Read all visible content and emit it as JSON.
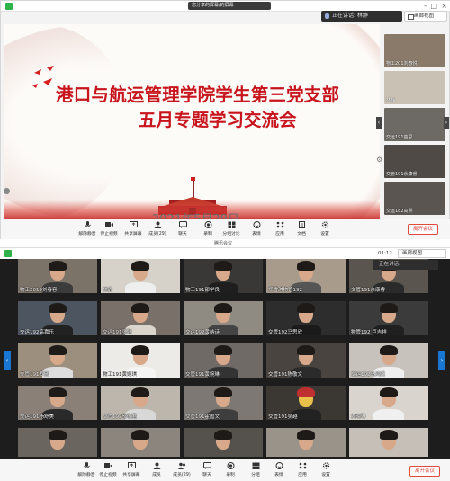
{
  "top_window": {
    "title": "您分享的屏幕/的屏幕",
    "speaking_label": "正在讲话: 林静",
    "gallery_view_label": "画廊视图",
    "slide": {
      "line1": "港口与航运管理学院学生第三党支部",
      "line2": "五月专题学习交流会",
      "date": "2021年5月28日"
    },
    "strip_tiles": [
      {
        "label": "物工201刘春悦"
      },
      {
        "label": "林静"
      },
      {
        "label": "交运191苗思"
      },
      {
        "label": "交管191余康睿"
      },
      {
        "label": "交运182高熙"
      }
    ],
    "toolbar": [
      {
        "label": "解除静音",
        "icon": "mic-icon"
      },
      {
        "label": "停止视频",
        "icon": "video-icon"
      },
      {
        "label": "共享屏幕",
        "icon": "share-screen-icon"
      },
      {
        "label": "成员(29)",
        "icon": "participants-icon"
      },
      {
        "label": "聊天",
        "icon": "chat-icon"
      },
      {
        "label": "录制",
        "icon": "record-icon"
      },
      {
        "label": "分组讨论",
        "icon": "breakout-icon"
      },
      {
        "label": "表情",
        "icon": "reaction-icon"
      },
      {
        "label": "应用",
        "icon": "apps-icon"
      },
      {
        "label": "文档",
        "icon": "docs-icon"
      },
      {
        "label": "设置",
        "icon": "settings-icon"
      }
    ],
    "leave_label": "离开会议"
  },
  "bottom_window": {
    "title": "腾讯会议",
    "time": "01:12",
    "gallery_view_label": "画廊视图",
    "speaking_label": "正在讲话:",
    "tiles": [
      {
        "name": "物工2019刘春容"
      },
      {
        "name": "林静"
      },
      {
        "name": "物工191邵学良"
      },
      {
        "name": "郑雪琪物管192"
      },
      {
        "name": "交管191余康睿"
      },
      {
        "name": "交运192高嘉乐"
      },
      {
        "name": "交运191张骁"
      },
      {
        "name": "交运192黄纳诗"
      },
      {
        "name": "交管192马思欣"
      },
      {
        "name": "物管192 卢吉祥"
      },
      {
        "name": "交管191罗欣"
      },
      {
        "name": "物工191黄婉琪"
      },
      {
        "name": "交管191黄婉琳"
      },
      {
        "name": "交管191陈敬文"
      },
      {
        "name": "交运192马鸿乘"
      },
      {
        "name": "交运191杨舒美"
      },
      {
        "name": "交管192邬敬君"
      },
      {
        "name": "交管191霍国文"
      },
      {
        "name": "交管191吴越"
      },
      {
        "name": "刘晓琳"
      },
      {
        "name": ""
      },
      {
        "name": ""
      },
      {
        "name": ""
      },
      {
        "name": ""
      },
      {
        "name": ""
      }
    ],
    "toolbar": [
      {
        "label": "解除静音",
        "icon": "mic-icon"
      },
      {
        "label": "停止视频",
        "icon": "video-icon"
      },
      {
        "label": "共享屏幕",
        "icon": "share-screen-icon"
      },
      {
        "label": "成员",
        "icon": "participants-icon"
      },
      {
        "label": "成员(29)",
        "icon": "members-icon"
      },
      {
        "label": "聊天",
        "icon": "chat-icon"
      },
      {
        "label": "录制",
        "icon": "record-icon"
      },
      {
        "label": "分组",
        "icon": "breakout-icon"
      },
      {
        "label": "表情",
        "icon": "reaction-icon"
      },
      {
        "label": "应用",
        "icon": "apps-icon"
      },
      {
        "label": "设置",
        "icon": "settings-icon"
      }
    ],
    "leave_label": "离开会议"
  },
  "colors": {
    "headline_red": "#c8141c",
    "leave_red": "#e04a3b",
    "nav_blue": "#1976d2"
  }
}
